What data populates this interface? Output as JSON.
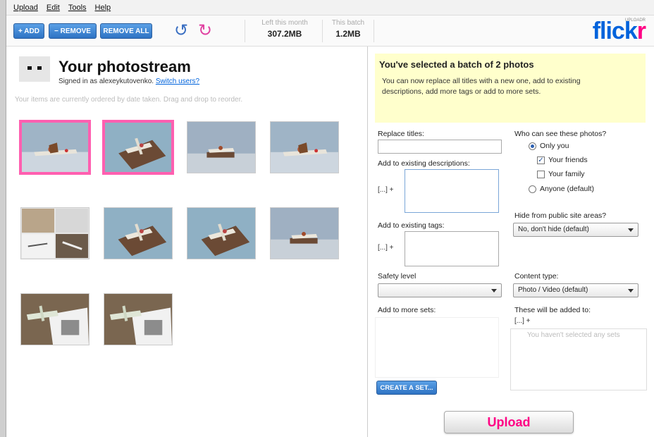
{
  "menu": [
    "Upload",
    "Edit",
    "Tools",
    "Help"
  ],
  "toolbar": {
    "add_label": "+ ADD",
    "remove_label": "− REMOVE",
    "remove_all_label": "REMOVE ALL",
    "rotate_left_icon": "rotate-left-icon",
    "rotate_right_icon": "rotate-right-icon",
    "left_this_month_label": "Left this month",
    "left_this_month_value": "307.2MB",
    "this_batch_label": "This batch",
    "this_batch_value": "1.2MB"
  },
  "logo": {
    "text_blue": "flick",
    "text_pink": "r",
    "sub": "UPLOADR"
  },
  "photostream": {
    "title": "Your photostream",
    "signed_prefix": "Signed in as alexeykutovenko.",
    "switch_users": "Switch users?",
    "order_note": "Your items are currently ordered by date taken. Drag and drop to reorder."
  },
  "photos": [
    {
      "id": 1,
      "selected": true,
      "scene": "plane"
    },
    {
      "id": 2,
      "selected": true,
      "scene": "diorama"
    },
    {
      "id": 3,
      "selected": false,
      "scene": "plane-small"
    },
    {
      "id": 4,
      "selected": false,
      "scene": "plane"
    },
    {
      "id": 5,
      "selected": false,
      "scene": "collage"
    },
    {
      "id": 6,
      "selected": false,
      "scene": "diorama"
    },
    {
      "id": 7,
      "selected": false,
      "scene": "diorama"
    },
    {
      "id": 8,
      "selected": false,
      "scene": "plane-small"
    },
    {
      "id": 9,
      "selected": false,
      "scene": "paper"
    },
    {
      "id": 10,
      "selected": false,
      "scene": "paper"
    }
  ],
  "batch": {
    "heading": "You've selected a batch of 2 photos",
    "description": "You can now replace all titles with a new one, add to existing descriptions, add more tags or add to more sets."
  },
  "form": {
    "replace_titles_label": "Replace titles:",
    "add_descriptions_label": "Add to existing descriptions:",
    "add_tags_label": "Add to existing tags:",
    "ellipsis": "[...] +",
    "safety_label": "Safety level",
    "safety_value": "",
    "add_sets_label": "Add to more sets:",
    "create_set_label": "CREATE A SET...",
    "who_label": "Who can see these photos?",
    "only_you": "Only you",
    "friends": "Your friends",
    "family": "Your family",
    "anyone": "Anyone (default)",
    "friends_checked": true,
    "family_checked": false,
    "hide_label": "Hide from public site areas?",
    "hide_value": "No, don't hide (default)",
    "content_label": "Content type:",
    "content_value": "Photo / Video (default)",
    "added_to_label": "These will be added to:",
    "added_ellipsis": "[...] +",
    "no_sets": "You haven't selected any sets"
  },
  "upload_label": "Upload",
  "colors": {
    "accent_blue": "#0063dc",
    "accent_pink": "#ff0084",
    "banner": "#ffffcc"
  }
}
